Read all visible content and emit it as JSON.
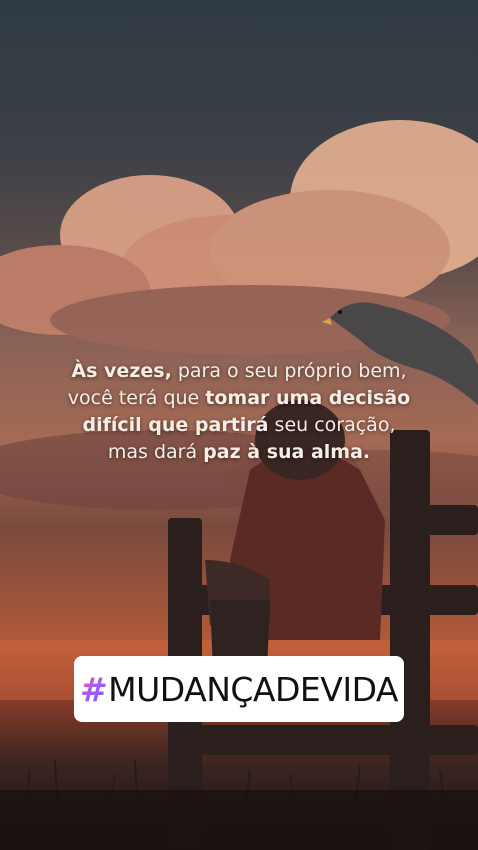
{
  "quote": {
    "line1": {
      "b1": "Às vezes,",
      "t1": " para o seu próprio bem,"
    },
    "line2": {
      "t1": "você terá que ",
      "b1": "tomar uma decisão"
    },
    "line3": {
      "b1": "difícil que partirá",
      "t1": " seu coração,"
    },
    "line4": {
      "t1": "mas dará ",
      "b1": "paz à sua alma."
    }
  },
  "sticker": {
    "hash": "#",
    "text": "MUDANÇADEVIDA",
    "gradient_colors": [
      "#ff5a8a",
      "#9b5cff",
      "#6a5cff"
    ]
  },
  "colors": {
    "sky_top": "#2f3a42",
    "sunset": "#b25a3a",
    "ground": "#1a1412"
  }
}
